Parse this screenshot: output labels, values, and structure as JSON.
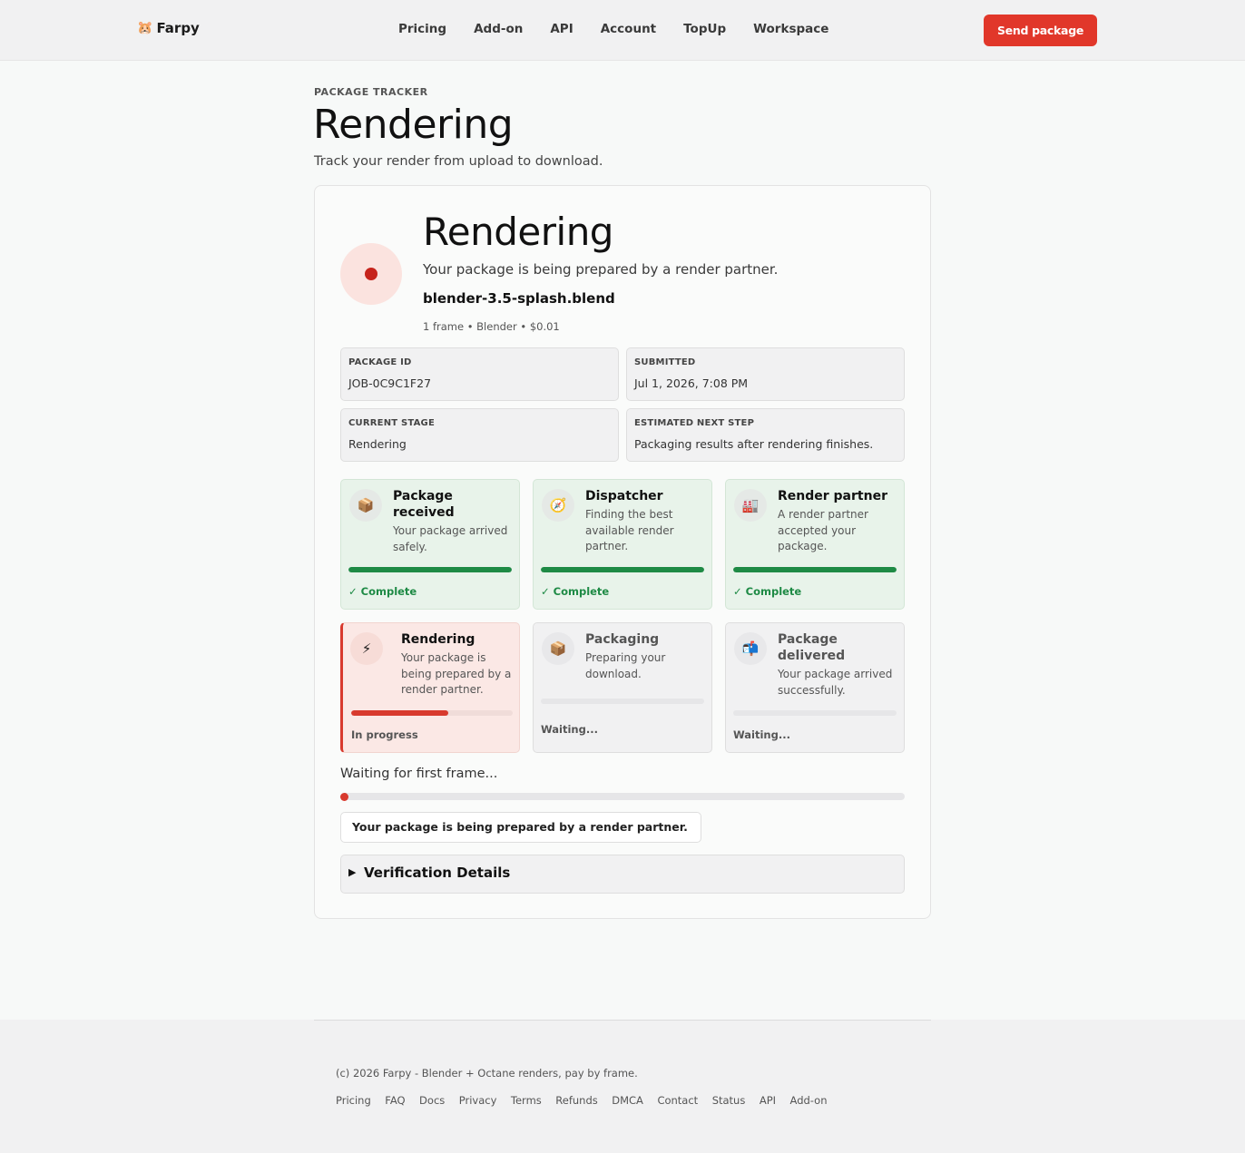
{
  "nav": {
    "brand": "Farpy",
    "brand_icon": "hamster-emoji",
    "links": [
      "Pricing",
      "Add-on",
      "API",
      "Account",
      "TopUp",
      "Workspace"
    ],
    "cta": "Send package"
  },
  "header": {
    "eyebrow": "PACKAGE TRACKER",
    "title": "Rendering",
    "subtitle": "Track your render from upload to download."
  },
  "status": {
    "title": "Rendering",
    "subtitle": "Your package is being prepared by a render partner.",
    "file": "blender-3.5-splash.blend",
    "meta": "1 frame • Blender • $0.01",
    "accent_color": "#c6241c"
  },
  "info": [
    {
      "label": "PACKAGE ID",
      "value": "JOB-0C9C1F27"
    },
    {
      "label": "SUBMITTED",
      "value": "Jul 1, 2026, 7:08 PM"
    },
    {
      "label": "CURRENT STAGE",
      "value": "Rendering"
    },
    {
      "label": "ESTIMATED NEXT STEP",
      "value": "Packaging results after rendering finishes."
    }
  ],
  "stages": [
    {
      "icon": "📦",
      "icon_name": "package-icon",
      "title": "Package received",
      "desc": "Your package arrived safely.",
      "state": "✓ Complete",
      "status": "done",
      "progress": 1.0
    },
    {
      "icon": "🧭",
      "icon_name": "compass-icon",
      "title": "Dispatcher",
      "desc": "Finding the best available render partner.",
      "state": "✓ Complete",
      "status": "done",
      "progress": 1.0
    },
    {
      "icon": "🏭",
      "icon_name": "factory-icon",
      "title": "Render partner",
      "desc": "A render partner accepted your package.",
      "state": "✓ Complete",
      "status": "done",
      "progress": 1.0
    },
    {
      "icon": "⚡",
      "icon_name": "lightning-icon",
      "title": "Rendering",
      "desc": "Your package is being prepared by a render partner.",
      "state": "In progress",
      "status": "active",
      "progress": 0.6
    },
    {
      "icon": "📦",
      "icon_name": "package-icon",
      "title": "Packaging",
      "desc": "Preparing your download.",
      "state": "Waiting...",
      "status": "wait",
      "progress": 0
    },
    {
      "icon": "📬",
      "icon_name": "mailbox-icon",
      "title": "Package delivered",
      "desc": "Your package arrived successfully.",
      "state": "Waiting...",
      "status": "wait",
      "progress": 0
    }
  ],
  "frame": {
    "status": "Waiting for first frame...",
    "message": "Your package is being prepared by a render partner.",
    "progress": 0
  },
  "verification": {
    "label": "Verification Details"
  },
  "footer": {
    "copyright": "(c) 2026 Farpy - Blender + Octane renders, pay by frame.",
    "links": [
      "Pricing",
      "FAQ",
      "Docs",
      "Privacy",
      "Terms",
      "Refunds",
      "DMCA",
      "Contact",
      "Status",
      "API",
      "Add-on"
    ]
  }
}
